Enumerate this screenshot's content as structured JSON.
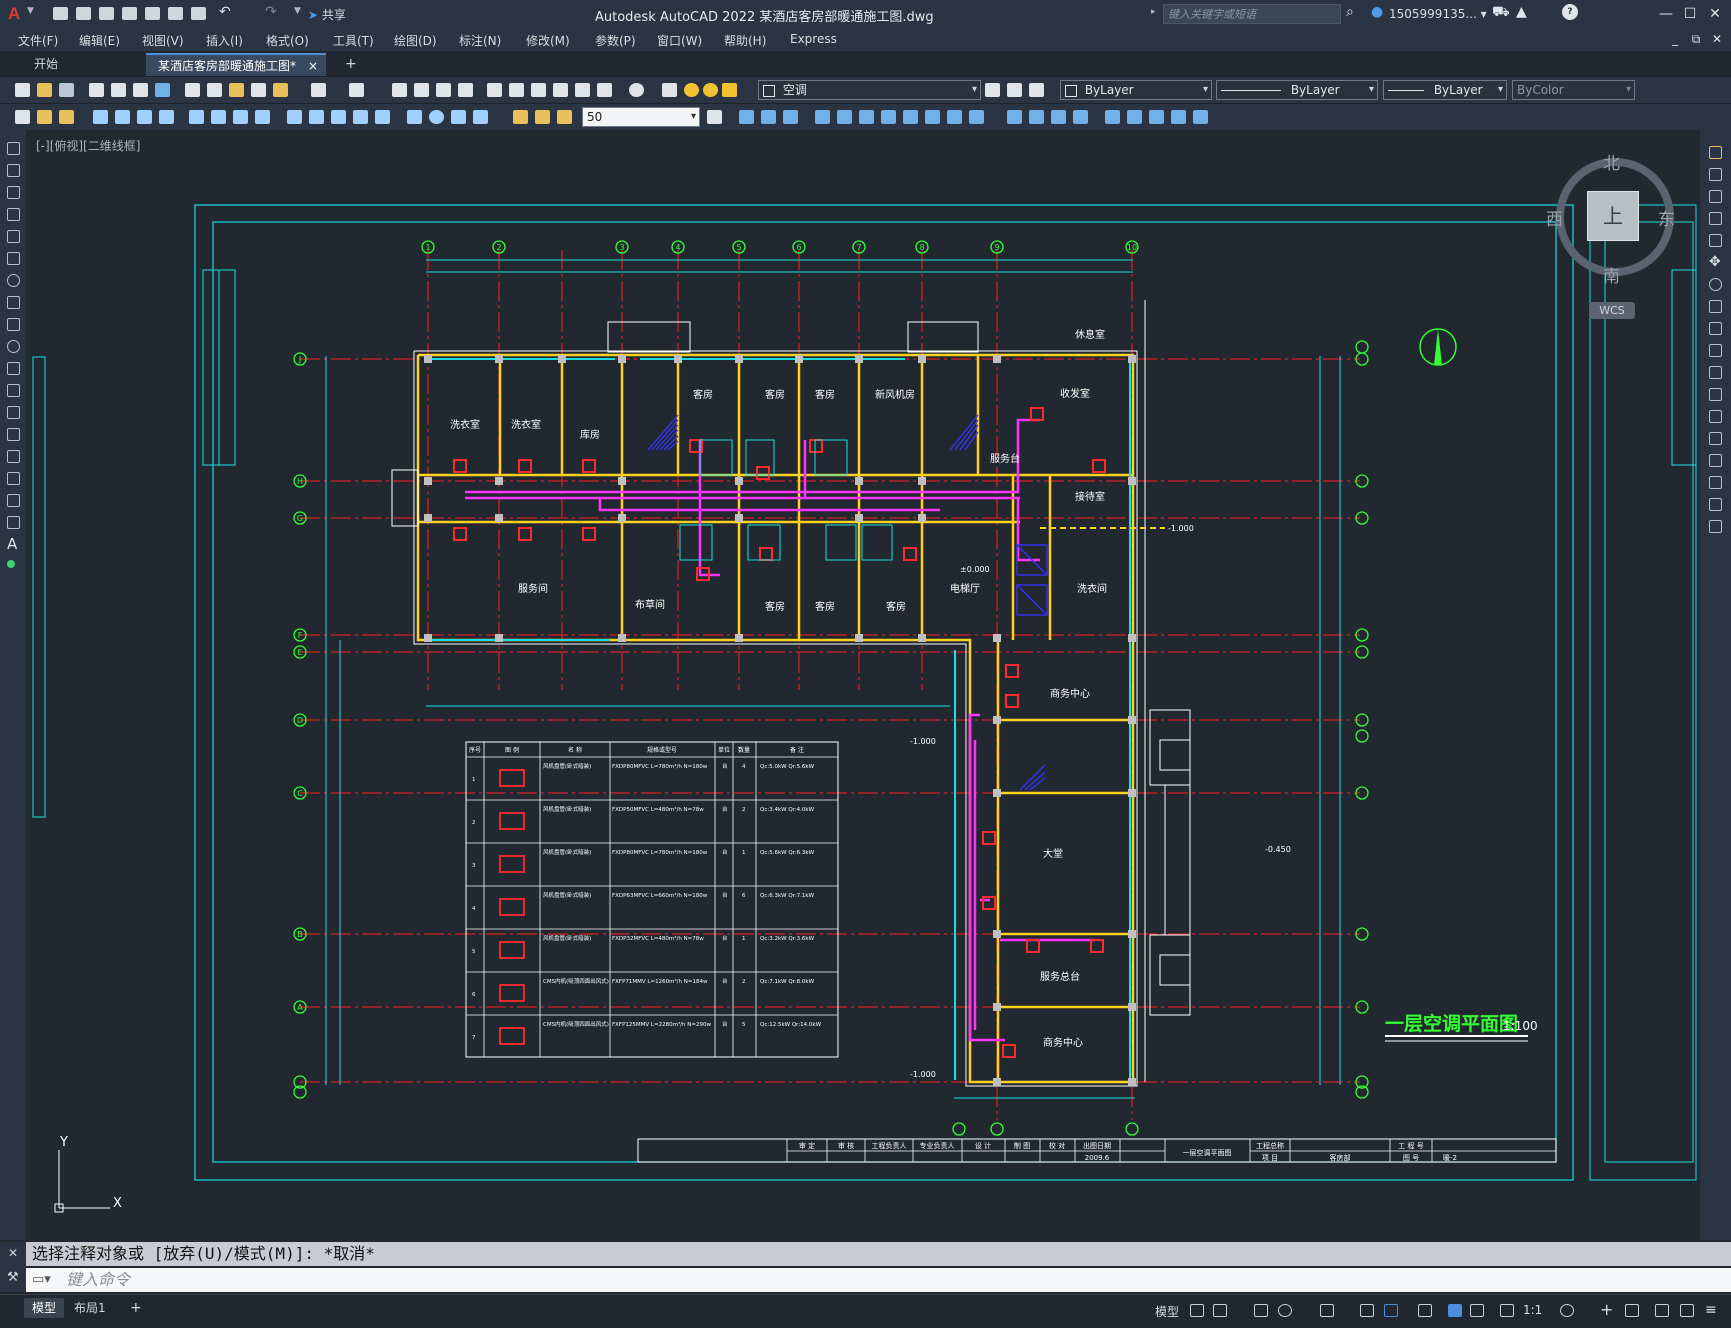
{
  "titlebar": {
    "app_logo": "A",
    "share": "共享",
    "title": "Autodesk AutoCAD 2022    某酒店客房部暖通施工图.dwg",
    "search_placeholder": "键入关键字或短语",
    "user": "1505999135... ▾",
    "help": "?"
  },
  "menu": {
    "items": [
      "文件(F)",
      "编辑(E)",
      "视图(V)",
      "插入(I)",
      "格式(O)",
      "工具(T)",
      "绘图(D)",
      "标注(N)",
      "修改(M)",
      "参数(P)",
      "窗口(W)",
      "帮助(H)",
      "Express"
    ]
  },
  "tabs": {
    "start": "开始",
    "active": "某酒店客房部暖通施工图*",
    "close": "×",
    "new": "+"
  },
  "toolbar1": {
    "layer": "空调",
    "color": "ByLayer",
    "linetype": "ByLayer",
    "lineweight": "ByLayer",
    "plotstyle": "ByColor"
  },
  "toolbar2": {
    "scale_value": "50"
  },
  "viewport": {
    "label": "[-][俯视][二维线框]"
  },
  "navigation": {
    "north": "北",
    "south": "南",
    "east": "东",
    "west": "西",
    "top_face": "上",
    "wcs": "WCS"
  },
  "drawing": {
    "title": "一层空调平面图",
    "scale": "1:100",
    "rooms": [
      "服务间",
      "洗衣室",
      "洗衣室",
      "客房",
      "客房",
      "客房",
      "新风机房",
      "服务台",
      "收发室",
      "客房",
      "客房",
      "客房",
      "电梯厅",
      "洗衣间",
      "商务中心",
      "大堂",
      "服务总台",
      "商务中心",
      "接待室",
      "布草间",
      "库房",
      "休息室"
    ],
    "grid_top": [
      "1",
      "2",
      "3",
      "4",
      "5",
      "6",
      "7",
      "8",
      "9",
      "10",
      "11"
    ],
    "grid_left": [
      "A",
      "B",
      "C",
      "D",
      "E",
      "F",
      "G",
      "H",
      "J"
    ],
    "level_marks": [
      "-1.000",
      "±0.000",
      "-0.450",
      "-1.000",
      "-1.000"
    ]
  },
  "equipment_table": {
    "headers": [
      "序号",
      "图 例",
      "名 称",
      "规格或型号",
      "单位",
      "数量",
      "备 注"
    ],
    "rows": [
      {
        "no": "1",
        "name": "风机盘管(卧式暗装)",
        "model": "FXDP80MFVC L=780m³/h N=180w",
        "unit": "台",
        "qty": "4",
        "note": "Qc:5.0kW Qr:5.6kW"
      },
      {
        "no": "2",
        "name": "风机盘管(卧式暗装)",
        "model": "FXDP50MFVC L=480m³/h N=78w",
        "unit": "台",
        "qty": "2",
        "note": "Qc:3.4kW Qr:4.0kW"
      },
      {
        "no": "3",
        "name": "风机盘管(卧式暗装)",
        "model": "FXDP80MFVC L=780m³/h N=180w",
        "unit": "台",
        "qty": "1",
        "note": "Qc:5.6kW Qr:6.3kW"
      },
      {
        "no": "4",
        "name": "风机盘管(卧式暗装)",
        "model": "FXDP63MFVC L=660m³/h N=180w",
        "unit": "台",
        "qty": "6",
        "note": "Qc:6.3kW Qr:7.1kW"
      },
      {
        "no": "5",
        "name": "风机盘管(卧式暗装)",
        "model": "FXDP32MFVC L=480m³/h N=78w",
        "unit": "台",
        "qty": "1",
        "note": "Qc:3.2kW Qr:3.6kW"
      },
      {
        "no": "6",
        "name": "CMS内机(吸顶四面出风式)",
        "model": "FXFP71MMV L=1260m³/h N=184w",
        "unit": "台",
        "qty": "2",
        "note": "Qc:7.1kW Qr:8.0kW"
      },
      {
        "no": "7",
        "name": "CMS内机(吸顶四面出风式)",
        "model": "FXFP125MMV L=2280m³/h N=290w",
        "unit": "台",
        "qty": "5",
        "note": "Qc:12.5kW Qr:14.0kW"
      }
    ]
  },
  "title_block": {
    "cells": [
      "审 定",
      "审 核",
      "工程负责人",
      "专业负责人",
      "设 计",
      "制 图",
      "校 对",
      "出图日期",
      "一层空调平面图",
      "工程总称",
      "工 程 号",
      "项 目",
      "图 号",
      "暖-2",
      "2009.6",
      "客房部"
    ]
  },
  "command": {
    "history": "选择注释对象或 [放弃(U)/模式(M)]: *取消*",
    "placeholder": "键入命令"
  },
  "statusbar": {
    "model_tab": "模型",
    "layout_tab": "布局1",
    "add": "+",
    "model_label": "模型",
    "scale": "1:1"
  },
  "colors": {
    "background": "#212830",
    "wall": "#ffffff",
    "column": "#c0c0c0",
    "axis": "#ff2020",
    "grid_bubble": "#33ff33",
    "frame": "#19e0e0",
    "pipe": "#ff33ff",
    "duct": "#ffd21f",
    "fcu": "#ff2a2a",
    "stair": "#3434ff",
    "accent": "#4c8ed9"
  }
}
